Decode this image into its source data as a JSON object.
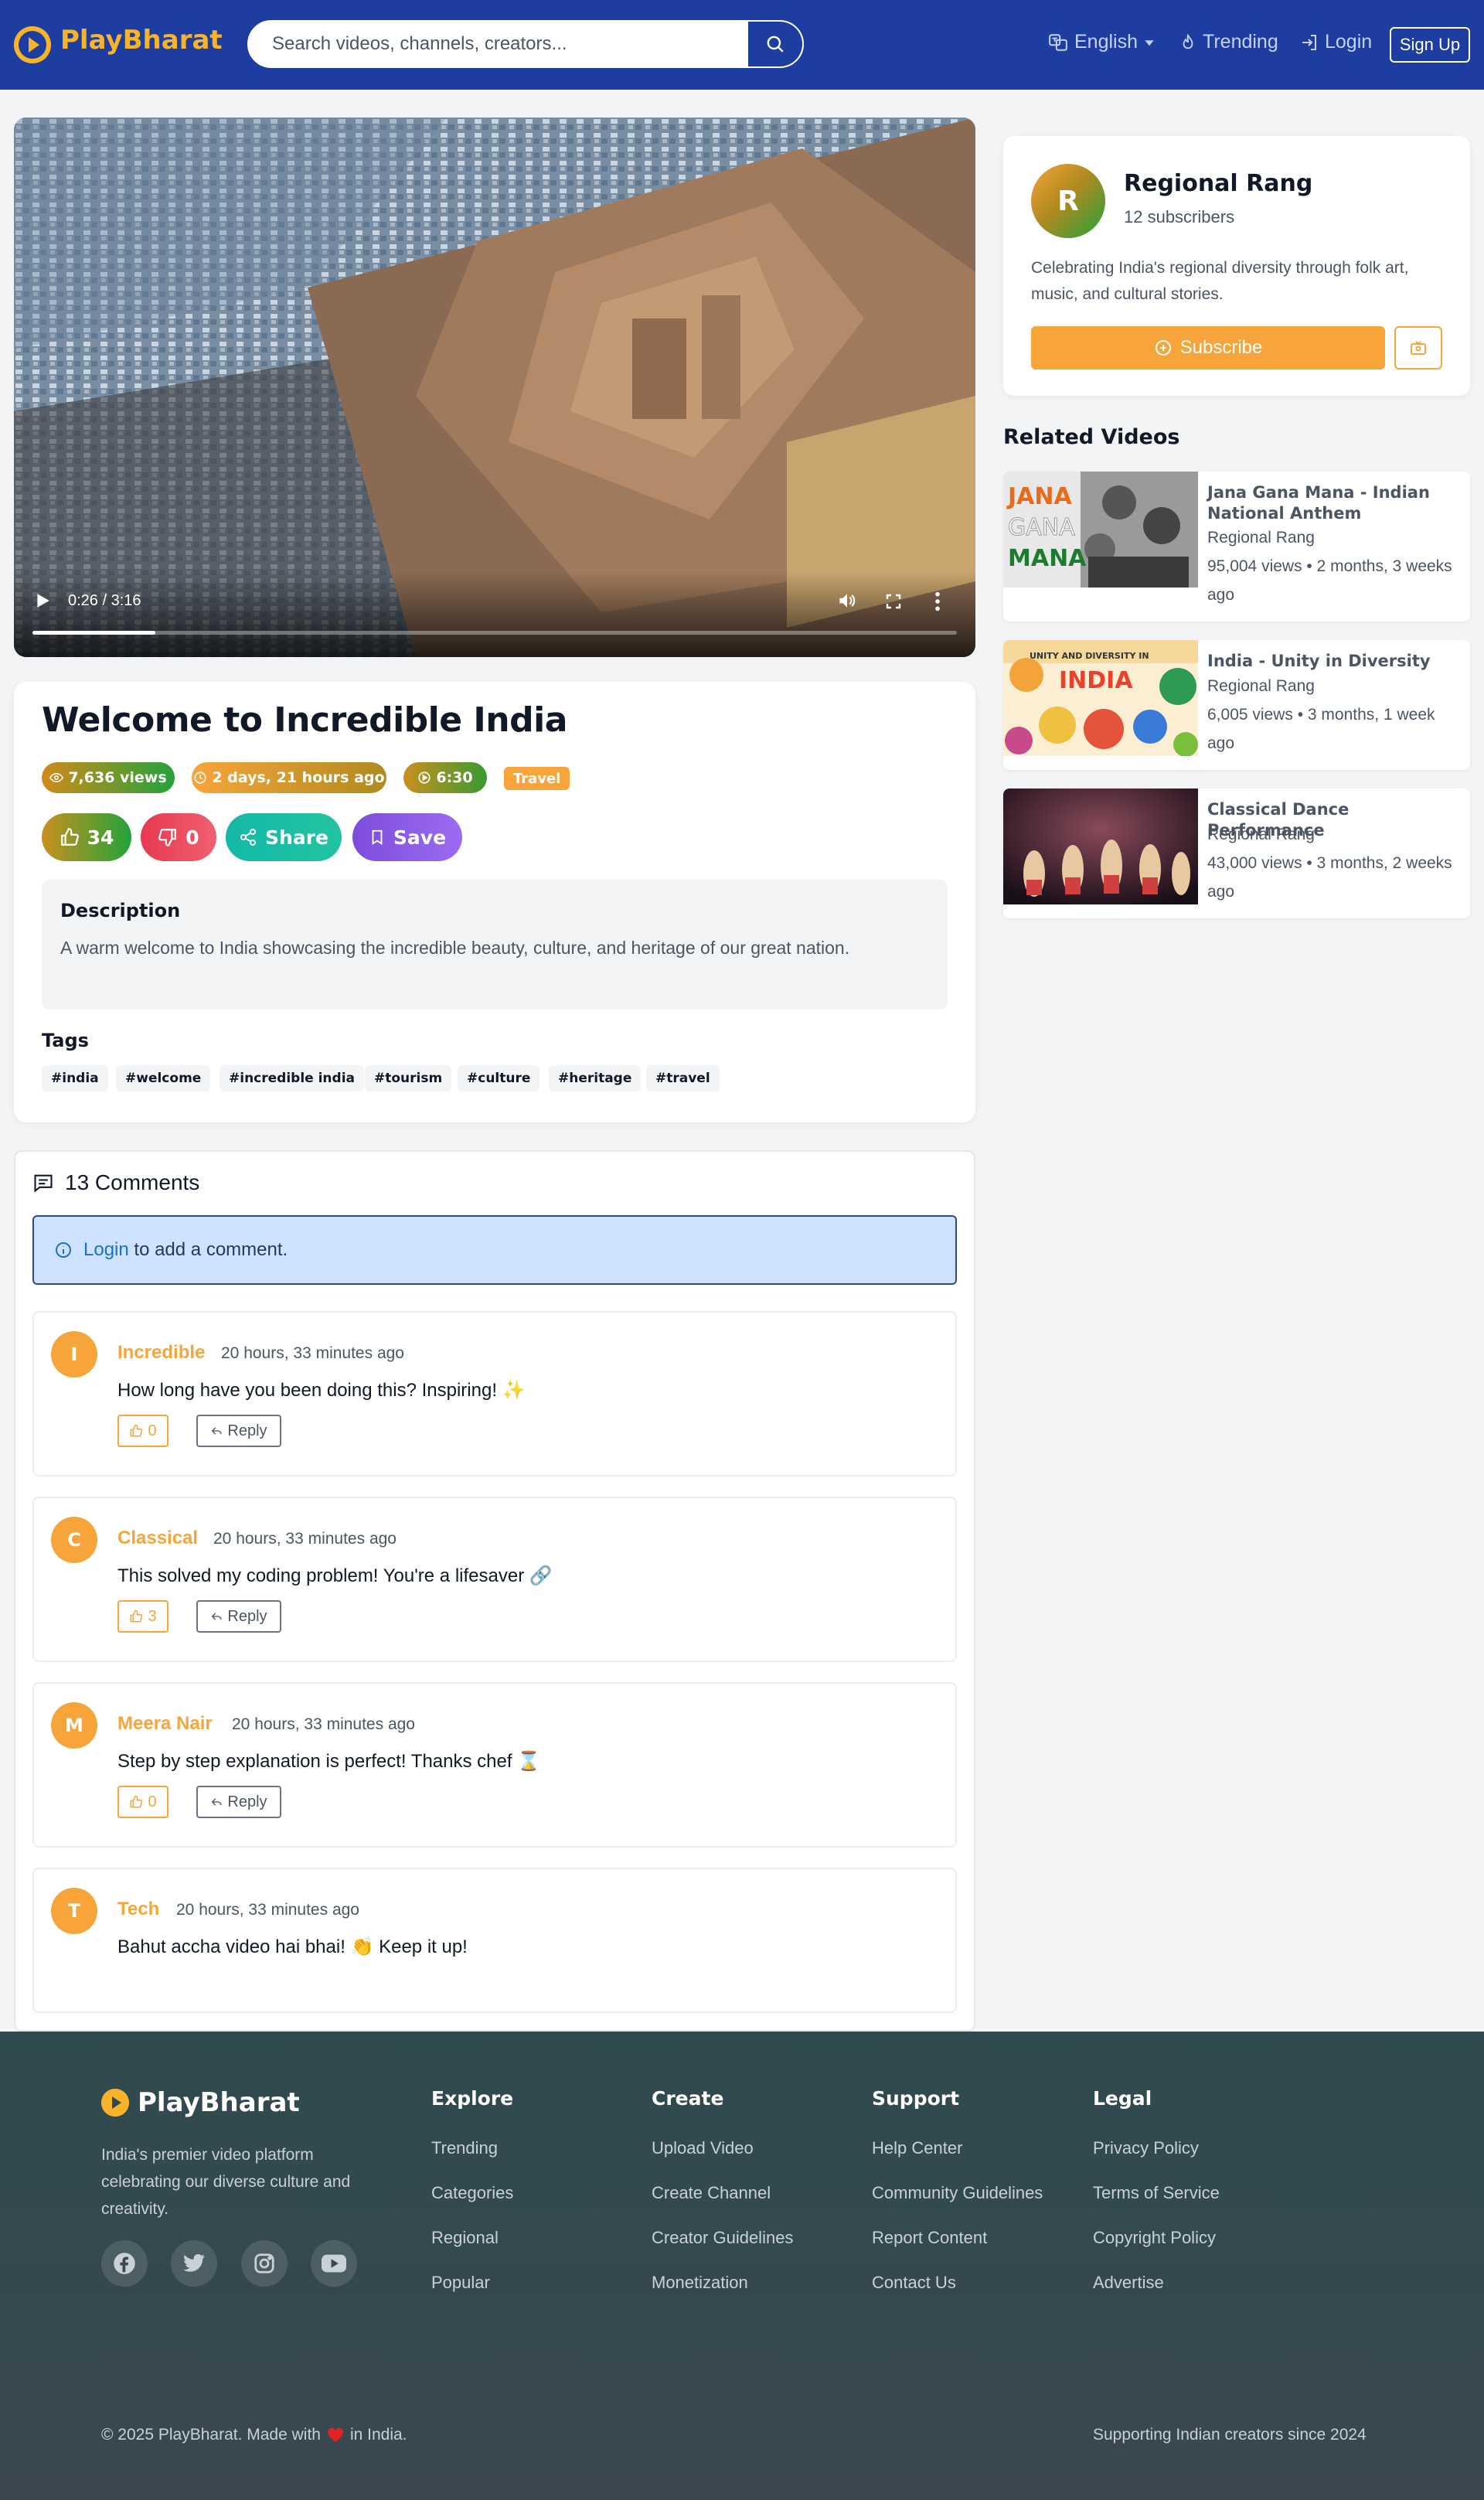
{
  "brand": {
    "name": "PlayBharat",
    "color": "#f7b42a"
  },
  "navbar": {
    "search_placeholder": "Search videos, channels, creators...",
    "language": "English",
    "trending": "Trending",
    "login": "Login",
    "signup": "Sign Up"
  },
  "video": {
    "current_time": "0:26 / 3:16",
    "progress": 0.133,
    "title": "Welcome to Incredible India",
    "views": "7,636 views",
    "uploaded": "2 days, 21 hours ago",
    "duration": "6:30",
    "category": "Travel",
    "likes": "34",
    "dislikes": "0",
    "share_label": "Share",
    "save_label": "Save",
    "description_title": "Description",
    "description": "A warm welcome to India showcasing the incredible beauty, culture, and heritage of our great nation.",
    "tags_title": "Tags",
    "tags": [
      "#india",
      "#welcome",
      "#incredible india",
      "#tourism",
      "#culture",
      "#heritage",
      "#travel"
    ]
  },
  "comments": {
    "heading": "13 Comments",
    "login_link": "Login",
    "login_prompt": " to add a comment.",
    "reply_label": "Reply",
    "items": [
      {
        "initial": "I",
        "name": "Incredible",
        "time": "20 hours, 33 minutes ago",
        "text": "How long have you been doing this? Inspiring! ✨",
        "likes": "0"
      },
      {
        "initial": "C",
        "name": "Classical",
        "time": "20 hours, 33 minutes ago",
        "text": "This solved my coding problem! You're a lifesaver 🔗",
        "likes": "3"
      },
      {
        "initial": "M",
        "name": "Meera Nair",
        "time": "20 hours, 33 minutes ago",
        "text": "Step by step explanation is perfect! Thanks chef ⌛",
        "likes": "0"
      },
      {
        "initial": "T",
        "name": "Tech",
        "time": "20 hours, 33 minutes ago",
        "text": "Bahut accha video hai bhai! 👏 Keep it up!",
        "likes": ""
      }
    ]
  },
  "channel": {
    "initial": "R",
    "name": "Regional Rang",
    "subscribers": "12 subscribers",
    "description": "Celebrating India's regional diversity through folk art, music, and cultural stories.",
    "subscribe_label": "Subscribe"
  },
  "related": {
    "heading": "Related Videos",
    "items": [
      {
        "title": "Jana Gana Mana - Indian National Anthem",
        "channel": "Regional Rang",
        "meta": "95,004 views • 2 months, 3 weeks ago"
      },
      {
        "title": "India - Unity in Diversity",
        "channel": "Regional Rang",
        "meta": "6,005 views • 3 months, 1 week ago"
      },
      {
        "title": "Classical Dance Performance",
        "channel": "Regional Rang",
        "meta": "43,000 views • 3 months, 2 weeks ago"
      }
    ],
    "thumb_texts": {
      "jana1": "JANA",
      "jana2": "GANA",
      "jana3": "MANA",
      "unity_top": "UNITY AND DIVERSITY IN",
      "unity_main": "INDIA"
    }
  },
  "footer": {
    "brand": "PlayBharat",
    "about": "India's premier video platform celebrating our diverse culture and creativity.",
    "columns": [
      {
        "title": "Explore",
        "links": [
          "Trending",
          "Categories",
          "Regional",
          "Popular"
        ]
      },
      {
        "title": "Create",
        "links": [
          "Upload Video",
          "Create Channel",
          "Creator Guidelines",
          "Monetization"
        ]
      },
      {
        "title": "Support",
        "links": [
          "Help Center",
          "Community Guidelines",
          "Report Content",
          "Contact Us"
        ]
      },
      {
        "title": "Legal",
        "links": [
          "Privacy Policy",
          "Terms of Service",
          "Copyright Policy",
          "Advertise"
        ]
      }
    ],
    "copyright_pre": "© 2025 PlayBharat. Made with",
    "copyright_post": "in India.",
    "tagline": "Supporting Indian creators since 2024"
  },
  "colors": {
    "navbar": "#1e3da0",
    "accent_orange": "#f7a53a",
    "share_teal": "#14b8a6",
    "save_purple": "#8b5cf6",
    "dislike_red": "#ef4444"
  }
}
